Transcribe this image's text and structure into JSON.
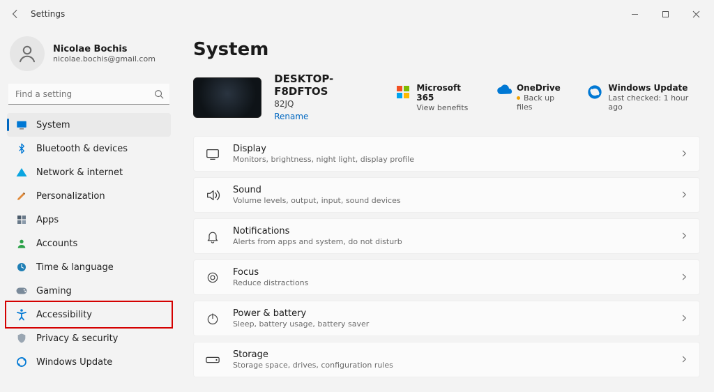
{
  "window": {
    "title": "Settings"
  },
  "user": {
    "name": "Nicolae Bochis",
    "email": "nicolae.bochis@gmail.com"
  },
  "search": {
    "placeholder": "Find a setting"
  },
  "sidebar": {
    "items": [
      {
        "id": "system",
        "label": "System"
      },
      {
        "id": "bluetooth",
        "label": "Bluetooth & devices"
      },
      {
        "id": "network",
        "label": "Network & internet"
      },
      {
        "id": "personalization",
        "label": "Personalization"
      },
      {
        "id": "apps",
        "label": "Apps"
      },
      {
        "id": "accounts",
        "label": "Accounts"
      },
      {
        "id": "time",
        "label": "Time & language"
      },
      {
        "id": "gaming",
        "label": "Gaming"
      },
      {
        "id": "accessibility",
        "label": "Accessibility"
      },
      {
        "id": "privacy",
        "label": "Privacy & security"
      },
      {
        "id": "update",
        "label": "Windows Update"
      }
    ],
    "selected": "system",
    "highlighted": "accessibility"
  },
  "page": {
    "title": "System",
    "device": {
      "name": "DESKTOP-F8DFTOS",
      "model": "82JQ",
      "rename_label": "Rename"
    },
    "tilelinks": [
      {
        "id": "ms365",
        "title": "Microsoft 365",
        "sub": "View benefits"
      },
      {
        "id": "onedrive",
        "title": "OneDrive",
        "sub": "Back up files",
        "attention": true
      },
      {
        "id": "update",
        "title": "Windows Update",
        "sub": "Last checked: 1 hour ago"
      }
    ],
    "cards": [
      {
        "id": "display",
        "title": "Display",
        "sub": "Monitors, brightness, night light, display profile"
      },
      {
        "id": "sound",
        "title": "Sound",
        "sub": "Volume levels, output, input, sound devices"
      },
      {
        "id": "notifications",
        "title": "Notifications",
        "sub": "Alerts from apps and system, do not disturb"
      },
      {
        "id": "focus",
        "title": "Focus",
        "sub": "Reduce distractions"
      },
      {
        "id": "power",
        "title": "Power & battery",
        "sub": "Sleep, battery usage, battery saver"
      },
      {
        "id": "storage",
        "title": "Storage",
        "sub": "Storage space, drives, configuration rules"
      }
    ]
  },
  "colors": {
    "accent": "#0067c0",
    "highlight": "#d40000"
  }
}
